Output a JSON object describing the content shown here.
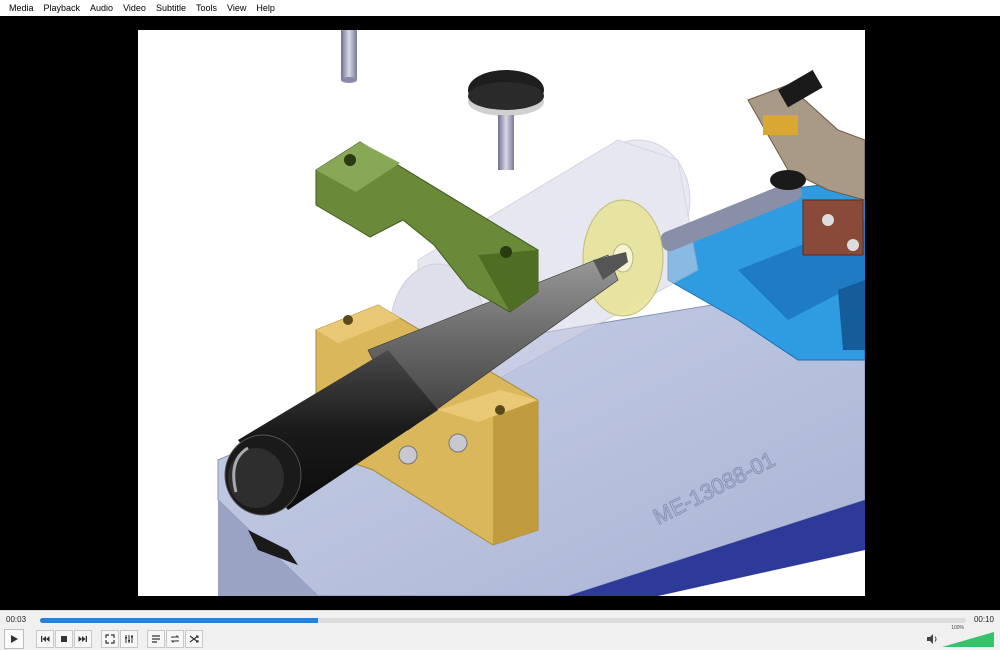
{
  "menu": [
    "Media",
    "Playback",
    "Audio",
    "Video",
    "Subtitle",
    "Tools",
    "View",
    "Help"
  ],
  "video": {
    "engraving": "ME-13088-01"
  },
  "playback": {
    "elapsed": "00:03",
    "total": "00:10",
    "progress": 0.3
  },
  "volume": {
    "label": "100%",
    "level": 1.0
  },
  "icons": [
    "play-icon",
    "previous-icon",
    "stop-icon",
    "next-icon",
    "fullscreen-icon",
    "extended-settings-icon",
    "playlist-icon",
    "loop-icon",
    "shuffle-icon",
    "speaker-icon"
  ],
  "colors": {
    "seek_fill": "#2b7fd4",
    "volume_fill": "#34c26a"
  }
}
